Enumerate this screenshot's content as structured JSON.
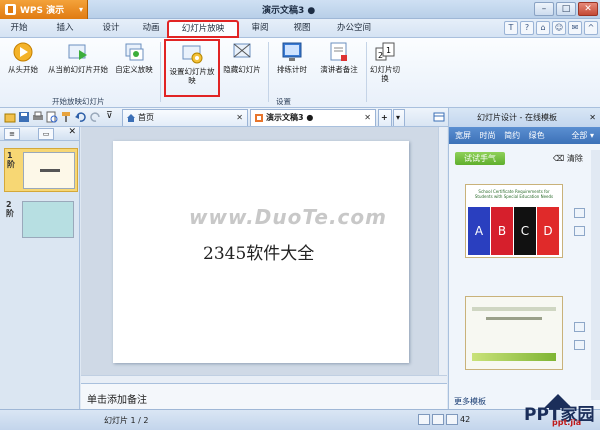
{
  "app": {
    "name": "WPS 演示",
    "doc_title": "演示文稿3 ●"
  },
  "menu_tabs": [
    "开始",
    "插入",
    "设计",
    "动画",
    "幻灯片放映",
    "审阅",
    "视图",
    "办公空间"
  ],
  "ribbon": {
    "buttons": [
      {
        "label": "从头开始",
        "icon": "play-icon"
      },
      {
        "label": "从当前幻灯片开始",
        "icon": "play-current-icon"
      },
      {
        "label": "自定义放映",
        "icon": "custom-show-icon"
      },
      {
        "label": "设置幻灯片放映",
        "icon": "settings-slideshow-icon"
      },
      {
        "label": "隐藏幻灯片",
        "icon": "hide-slide-icon"
      },
      {
        "label": "排练计时",
        "icon": "rehearse-timer-icon"
      },
      {
        "label": "演讲者备注",
        "icon": "speaker-notes-icon"
      },
      {
        "label": "幻灯片切换",
        "icon": "slide-transition-icon"
      }
    ],
    "group_labels": [
      "开始放映幻灯片",
      "设置"
    ]
  },
  "tabs": [
    {
      "label": "首页",
      "active": false
    },
    {
      "label": "演示文稿3 ●",
      "active": true
    }
  ],
  "slides": [
    {
      "number": "1",
      "extra": "阶"
    },
    {
      "number": "2",
      "extra": "阶"
    }
  ],
  "slide_content": {
    "text": "2345软件大全",
    "watermark": "www.DuoTe.com"
  },
  "notes_placeholder": "单击添加备注",
  "taskpane": {
    "title": "幻灯片设计 - 在线模板",
    "filters": [
      "宽屏",
      "时尚",
      "简约",
      "绿色"
    ],
    "filter_all": "全部",
    "try_label": "试试手气",
    "clear_label": "清除",
    "more_label": "更多模板",
    "template_title": "School Certificate Requirements for Students with Special Education Needs",
    "template_letters": [
      "A",
      "B",
      "C",
      "D"
    ]
  },
  "status": {
    "slide_info": "幻灯片 1 / 2",
    "zoom": "42"
  },
  "brand": {
    "name": "PPT家园",
    "sub": "ppt.jia"
  }
}
